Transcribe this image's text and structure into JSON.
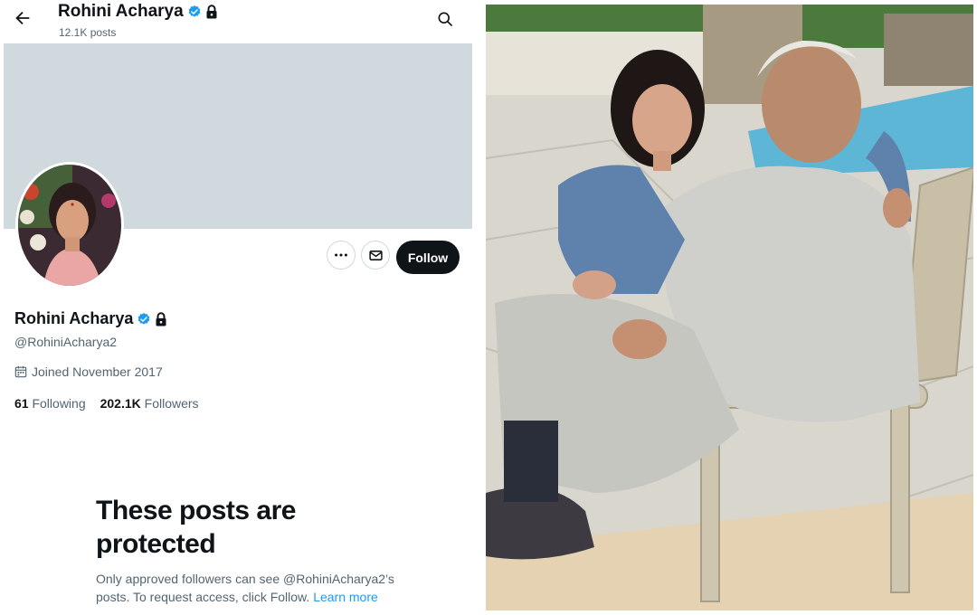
{
  "header": {
    "name": "Rohini Acharya",
    "posts_count": "12.1K posts",
    "back_icon": "arrow-left-icon",
    "search_icon": "search-icon"
  },
  "profile": {
    "display_name": "Rohini Acharya",
    "handle": "@RohiniAcharya2",
    "verified_icon": "verified-badge-icon",
    "protected_icon": "lock-icon",
    "joined": "Joined November 2017",
    "following_count": "61",
    "following_label": "Following",
    "followers_count": "202.1K",
    "followers_label": "Followers"
  },
  "actions": {
    "more_icon": "more-icon",
    "message_icon": "mail-icon",
    "follow_label": "Follow"
  },
  "protected_notice": {
    "title": "These posts are protected",
    "body": "Only approved followers can see @RohiniAcharya2’s posts. To request access, click Follow.",
    "link": "Learn more"
  },
  "colors": {
    "banner": "#cfd9de",
    "verified": "#1d9bf0",
    "link": "#1d9bf0",
    "follow_button": "#0f1419",
    "muted_text": "#536471"
  }
}
